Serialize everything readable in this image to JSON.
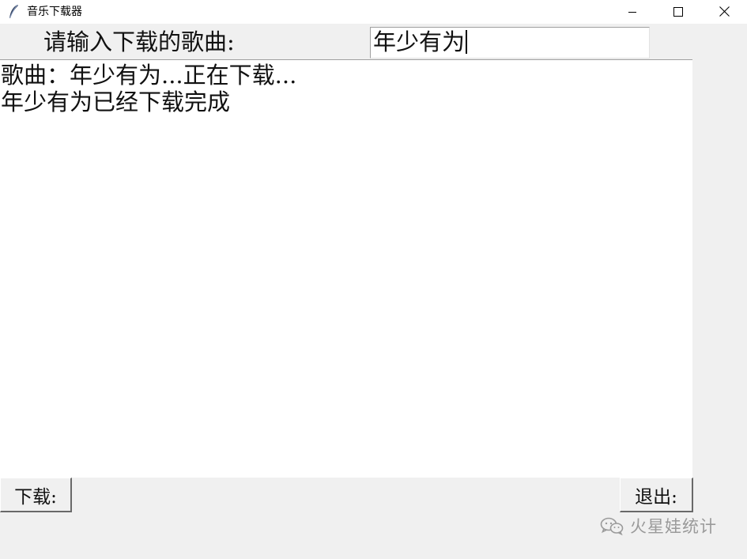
{
  "window": {
    "title": "音乐下载器",
    "icon": "feather-icon",
    "controls": [
      "minimize-icon",
      "maximize-icon",
      "close-icon"
    ]
  },
  "form": {
    "prompt_label": "请输入下载的歌曲:",
    "song_value": "年少有为"
  },
  "log": {
    "lines": [
      "歌曲：年少有为...正在下载...",
      "年少有为已经下载完成"
    ]
  },
  "buttons": {
    "download_label": "下载:",
    "quit_label": "退出:"
  },
  "watermark": {
    "text": "火星娃统计",
    "icon": "wechat-icon"
  }
}
